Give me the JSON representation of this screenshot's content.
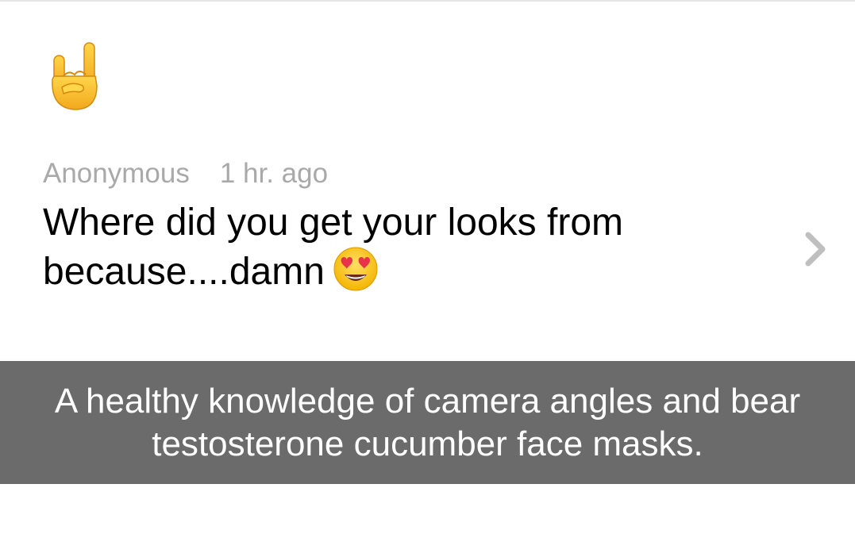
{
  "header": {
    "icon": "rock-on-hand-emoji"
  },
  "question": {
    "author": "Anonymous",
    "time": "1 hr. ago",
    "text_line1": "Where did you get your looks from",
    "text_line2": "because....damn",
    "emoji": "heart-eyes-emoji"
  },
  "caption": {
    "line1": "A healthy knowledge of camera angles and bear",
    "line2": "testosterone cucumber face masks."
  },
  "colors": {
    "meta_text": "#a9a9a9",
    "question_text": "#000000",
    "caption_bg": "#6b6b6b",
    "caption_text": "#ffffff",
    "emoji_yellow": "#f7c23a",
    "chevron": "#bfbfbf"
  }
}
